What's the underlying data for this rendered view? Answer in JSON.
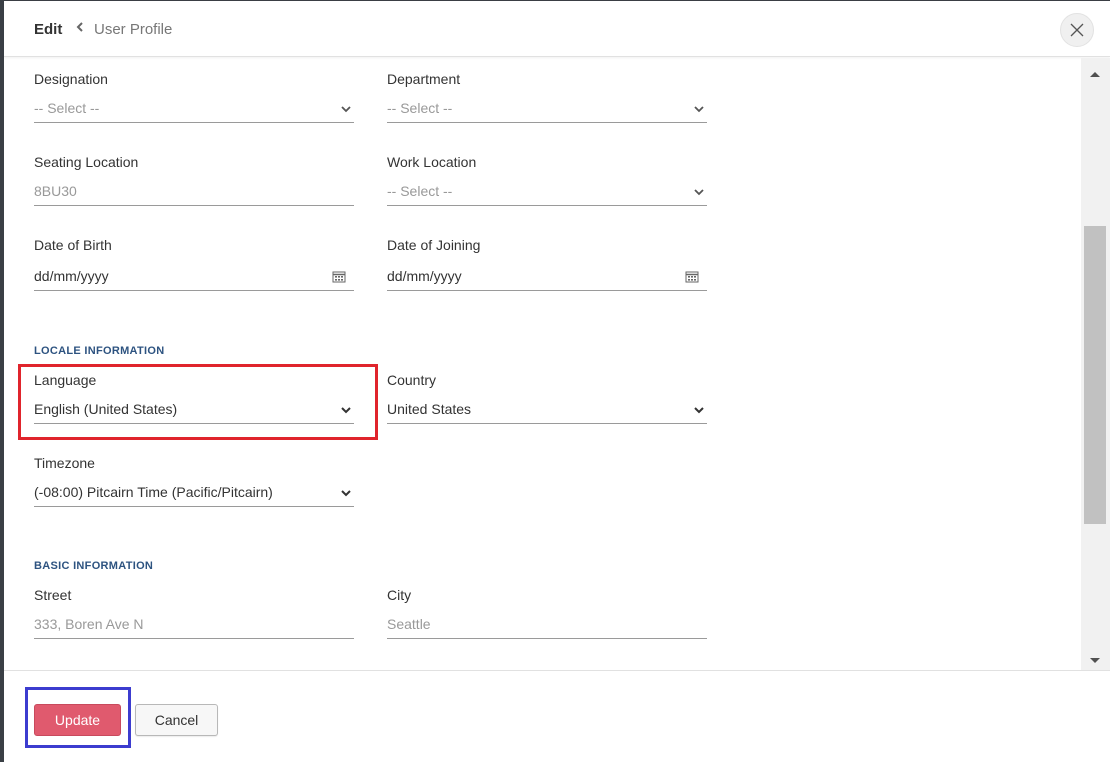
{
  "header": {
    "edit_label": "Edit",
    "breadcrumb": "User Profile"
  },
  "fields": {
    "designation": {
      "label": "Designation",
      "value": "-- Select --"
    },
    "department": {
      "label": "Department",
      "value": "-- Select --"
    },
    "seating_location": {
      "label": "Seating Location",
      "value": "8BU30"
    },
    "work_location": {
      "label": "Work Location",
      "value": "-- Select --"
    },
    "date_of_birth": {
      "label": "Date of Birth",
      "value": "dd/mm/yyyy"
    },
    "date_of_joining": {
      "label": "Date of Joining",
      "value": "dd/mm/yyyy"
    },
    "language": {
      "label": "Language",
      "value": "English (United States)"
    },
    "country": {
      "label": "Country",
      "value": "United States"
    },
    "timezone": {
      "label": "Timezone",
      "value": "(-08:00) Pitcairn Time (Pacific/Pitcairn)"
    },
    "street": {
      "label": "Street",
      "value": "333, Boren Ave N"
    },
    "city": {
      "label": "City",
      "value": "Seattle"
    }
  },
  "sections": {
    "locale": "LOCALE INFORMATION",
    "basic": "BASIC INFORMATION"
  },
  "footer": {
    "update_label": "Update",
    "cancel_label": "Cancel"
  },
  "colors": {
    "accent_button": "#e05a6e",
    "section_title": "#2d5380",
    "highlight_red": "#e0242c",
    "highlight_blue": "#3c3ccf"
  },
  "icons": {
    "close": "close-icon",
    "back": "chevron-left-icon",
    "dropdown": "chevron-down-icon",
    "calendar": "calendar-icon"
  }
}
